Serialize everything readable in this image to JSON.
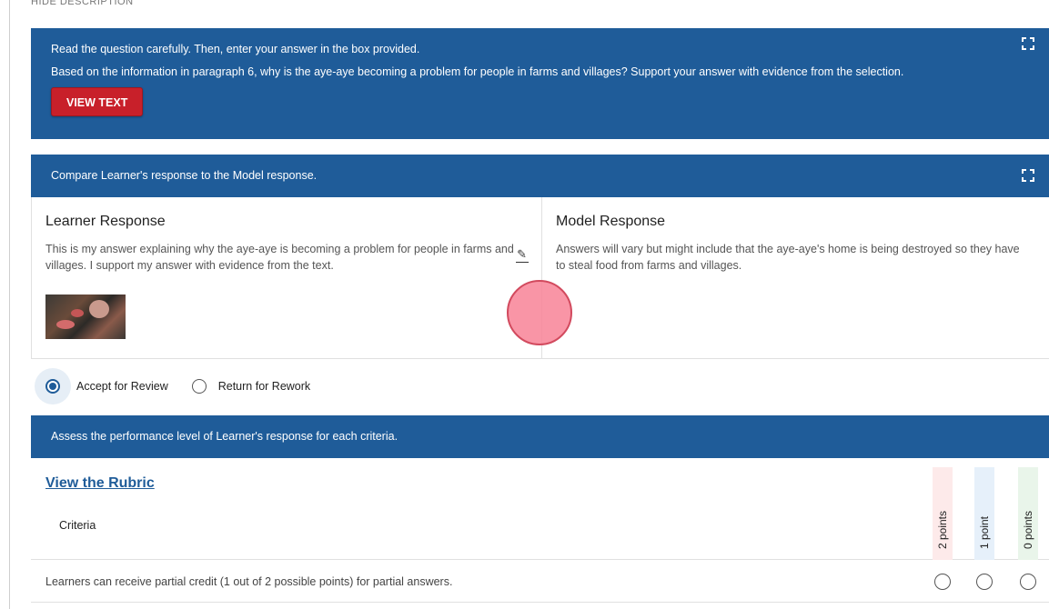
{
  "top_cut_label": "HIDE DESCRIPTION",
  "question_panel": {
    "instruction": "Read the question carefully. Then, enter your answer in the box provided.",
    "question": "Based on the information in paragraph 6, why is the aye-aye becoming a problem for people in farms and villages? Support your answer with evidence from the selection.",
    "view_text_label": "VIEW TEXT"
  },
  "compare_panel": {
    "header": "Compare Learner's response to the Model response.",
    "learner": {
      "title": "Learner Response",
      "text": "This is my answer explaining why the aye-aye is becoming a problem for people in farms and villages. I support my answer with evidence from the text."
    },
    "model": {
      "title": "Model Response",
      "text": "Answers will vary but might include that the aye-aye's home is being destroyed so they have to steal food from farms and villages."
    }
  },
  "review": {
    "accept_label": "Accept for Review",
    "rework_label": "Return for Rework",
    "selected": "accept"
  },
  "assess_panel": {
    "header": "Assess the performance level of Learner's response for each criteria.",
    "rubric_link": "View the Rubric",
    "criteria_header": "Criteria",
    "point_columns": [
      "2 points",
      "1 point",
      "0 points"
    ],
    "point_colors": [
      "#fdeaea",
      "#e6f0fa",
      "#e9f5ea"
    ],
    "rows": [
      {
        "text": "Learners can receive partial credit (1 out of 2 possible points) for partial answers."
      }
    ]
  },
  "colors": {
    "header_blue": "#1f5c99",
    "button_red": "#c8202a",
    "cursor_pink": "#f88296"
  }
}
